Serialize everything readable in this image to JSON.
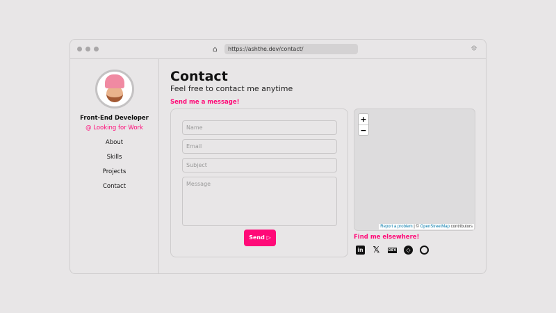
{
  "browser": {
    "url": "https://ashthe.dev/contact/"
  },
  "sidebar": {
    "role": "Front-End Developer",
    "status": "@ Looking for Work",
    "nav": [
      "About",
      "Skills",
      "Projects",
      "Contact"
    ]
  },
  "main": {
    "title": "Contact",
    "subtitle": "Feel free to contact me anytime",
    "form_heading": "Send me a message!",
    "placeholders": {
      "name": "Name",
      "email": "Email",
      "subject": "Subject",
      "message": "Message"
    },
    "send": "Send"
  },
  "map": {
    "zoom_in": "+",
    "zoom_out": "−",
    "report": "Report a problem",
    "sep": " | © ",
    "osm": "OpenStreetMap",
    "contrib": " contributors"
  },
  "social": {
    "heading": "Find me elsewhere!",
    "icons": [
      "linkedin-icon",
      "x-icon",
      "dev-icon",
      "codepen-icon",
      "github-icon"
    ]
  },
  "colors": {
    "accent": "#ff0a78"
  }
}
